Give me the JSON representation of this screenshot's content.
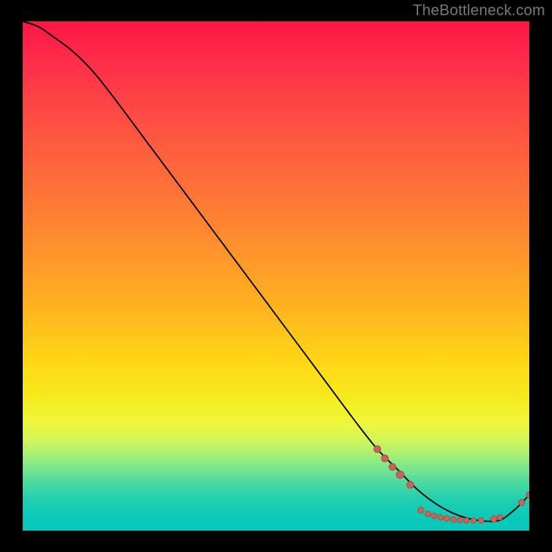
{
  "watermark": "TheBottleneck.com",
  "colors": {
    "curve": "#000000",
    "dot_fill": "#c9645b",
    "dot_stroke": "#a94a42",
    "background": "#000000"
  },
  "chart_data": {
    "type": "line",
    "title": "",
    "xlabel": "",
    "ylabel": "",
    "xlim": [
      0,
      100
    ],
    "ylim": [
      0,
      100
    ],
    "series": [
      {
        "name": "curve",
        "x": [
          0,
          3,
          6,
          10,
          14,
          18,
          24,
          30,
          36,
          42,
          48,
          54,
          60,
          66,
          70,
          74,
          78,
          82,
          86,
          90,
          94,
          97,
          100
        ],
        "y": [
          100,
          99,
          97,
          94,
          90,
          85,
          77,
          69,
          61,
          53,
          45,
          37,
          29,
          21,
          16,
          12,
          8,
          5,
          3,
          2,
          2,
          4,
          7
        ]
      }
    ],
    "scatter": [
      {
        "name": "dots",
        "points": [
          {
            "x": 70.0,
            "y": 16.0,
            "r": 5.0
          },
          {
            "x": 71.5,
            "y": 14.2,
            "r": 5.0
          },
          {
            "x": 73.0,
            "y": 12.5,
            "r": 5.0
          },
          {
            "x": 74.5,
            "y": 11.0,
            "r": 5.5
          },
          {
            "x": 76.5,
            "y": 9.0,
            "r": 5.0
          },
          {
            "x": 78.6,
            "y": 4.0,
            "r": 4.5
          },
          {
            "x": 80.0,
            "y": 3.3,
            "r": 4.0
          },
          {
            "x": 81.2,
            "y": 2.9,
            "r": 4.0
          },
          {
            "x": 82.5,
            "y": 2.6,
            "r": 4.0
          },
          {
            "x": 83.7,
            "y": 2.4,
            "r": 4.0
          },
          {
            "x": 85.0,
            "y": 2.2,
            "r": 4.0
          },
          {
            "x": 86.3,
            "y": 2.1,
            "r": 4.0
          },
          {
            "x": 87.6,
            "y": 2.0,
            "r": 4.0
          },
          {
            "x": 89.0,
            "y": 2.0,
            "r": 4.0
          },
          {
            "x": 90.5,
            "y": 2.0,
            "r": 4.0
          },
          {
            "x": 93.0,
            "y": 2.3,
            "r": 4.5
          },
          {
            "x": 94.2,
            "y": 2.6,
            "r": 4.0
          },
          {
            "x": 98.5,
            "y": 5.5,
            "r": 4.5
          },
          {
            "x": 100.0,
            "y": 7.0,
            "r": 4.5
          }
        ]
      }
    ]
  }
}
